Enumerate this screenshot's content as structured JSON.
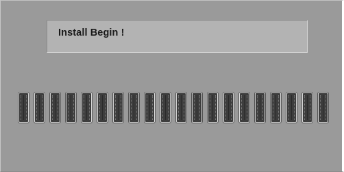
{
  "message": {
    "text": "Install Begin !"
  },
  "progress": {
    "segments": 20,
    "fraction": 1.0
  },
  "colors": {
    "screen_background": "#9a9a9a",
    "message_box_background": "#b3b3b3",
    "segment": "#3d3d3d"
  }
}
